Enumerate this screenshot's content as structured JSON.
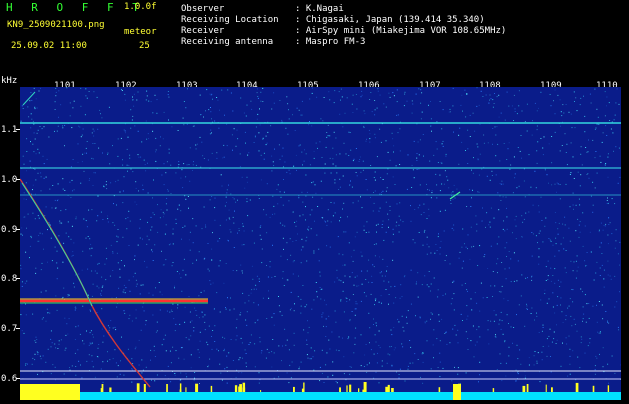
{
  "header": {
    "app_title": "H R O F F T",
    "version": "1.0.0f",
    "file_name": "KN9_2509021100.png",
    "meteor_label": "meteor",
    "date_time": "25.09.02 11:00",
    "meteor_count": "25",
    "info": [
      {
        "label": "Observer",
        "value": ": K.Nagai"
      },
      {
        "label": "Receiving Location",
        "value": ": Chigasaki, Japan (139.414 35.340)"
      },
      {
        "label": "Receiver",
        "value": ": AirSpy mini (Miakejima VOR 108.65MHz)"
      },
      {
        "label": "Receiving antenna",
        "value": ": Maspro FM-3"
      }
    ]
  },
  "axis": {
    "y_unit": "kHz",
    "y_ticks": [
      "1.1",
      "1.0",
      "0.9",
      "0.8",
      "0.7",
      "0.6"
    ],
    "x_ticks": [
      "1101",
      "1102",
      "1103",
      "1104",
      "1105",
      "1106",
      "1107",
      "1108",
      "1109",
      "1110"
    ]
  },
  "colors": {
    "background": "#000000",
    "spectrum_bg": "#0a1c8a",
    "label_yellow": "#ffff33",
    "title_green": "#33ff33"
  }
}
